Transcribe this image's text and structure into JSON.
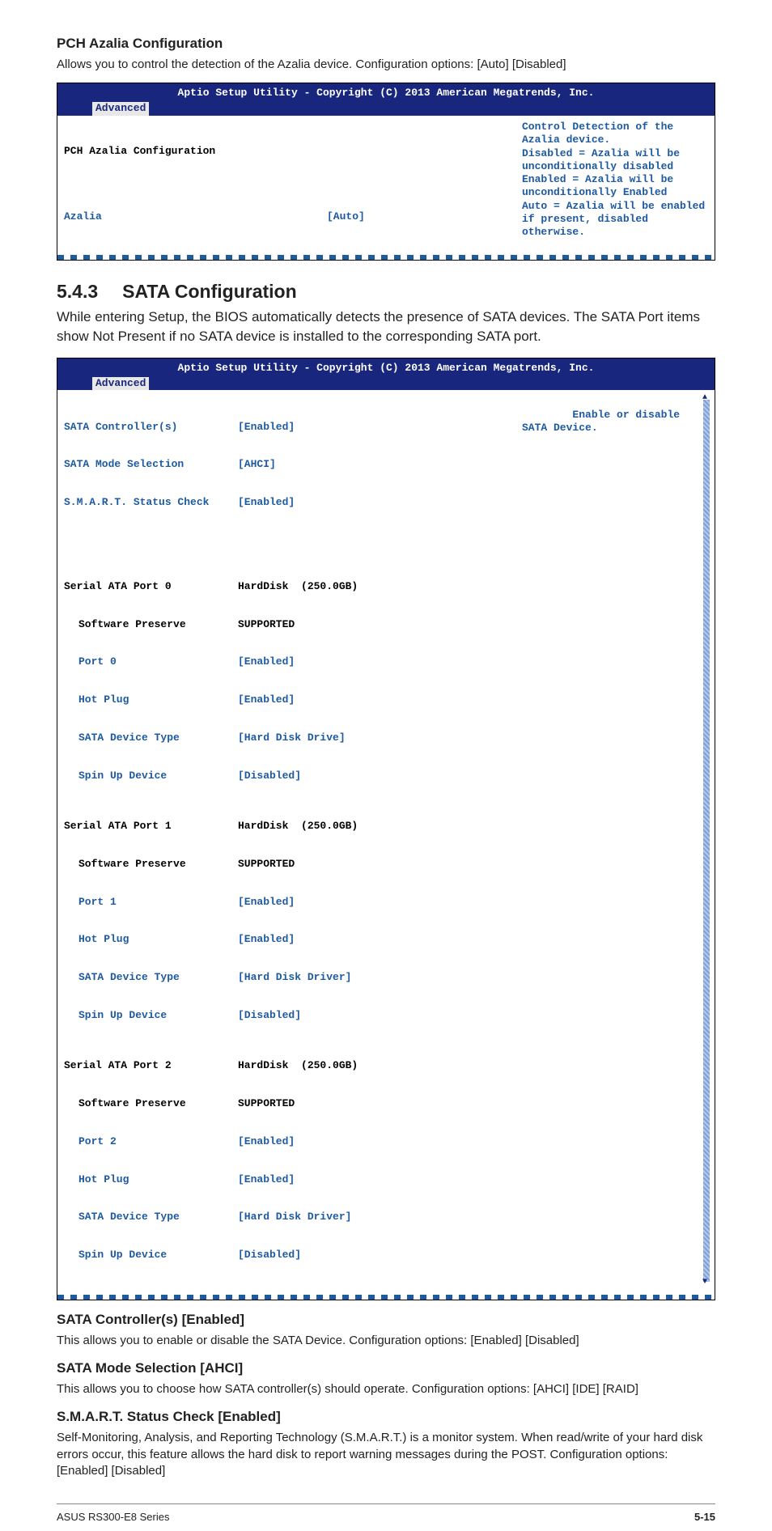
{
  "pch": {
    "heading": "PCH Azalia Configuration",
    "desc": "Allows you to control the detection of the Azalia device. Configuration options: [Auto] [Disabled]"
  },
  "bios1": {
    "title": "Aptio Setup Utility - Copyright (C) 2013 American Megatrends, Inc.",
    "tab": "Advanced",
    "left": {
      "row0_label": "PCH Azalia Configuration",
      "azalia_label": "Azalia",
      "azalia_value": "[Auto]"
    },
    "help": "Control Detection of the Azalia device.\nDisabled = Azalia will be unconditionally disabled\nEnabled = Azalia will be unconditionally Enabled\nAuto = Azalia will be enabled if present, disabled otherwise."
  },
  "section": {
    "number": "5.4.3",
    "title": "SATA Configuration",
    "intro": "While entering Setup, the BIOS automatically detects the presence of SATA devices. The SATA Port items show Not Present if no SATA device is installed to the corresponding SATA port."
  },
  "bios2": {
    "title": "Aptio Setup Utility - Copyright (C) 2013 American Megatrends, Inc.",
    "tab": "Advanced",
    "help": "Enable or disable SATA Device.",
    "rows": {
      "sata_controller_l": "SATA Controller(s)",
      "sata_controller_v": "[Enabled]",
      "sata_mode_l": "SATA Mode Selection",
      "sata_mode_v": "[AHCI]",
      "smart_l": "S.M.A.R.T. Status Check",
      "smart_v": "[Enabled]",
      "p0_l": "Serial ATA Port 0",
      "p0_v": "HardDisk  (250.0GB)",
      "p0_sw_l": "Software Preserve",
      "p0_sw_v": "SUPPORTED",
      "p0_port_l": "Port 0",
      "p0_port_v": "[Enabled]",
      "p0_hot_l": "Hot Plug",
      "p0_hot_v": "[Enabled]",
      "p0_type_l": "SATA Device Type",
      "p0_type_v": "[Hard Disk Drive]",
      "p0_spin_l": "Spin Up Device",
      "p0_spin_v": "[Disabled]",
      "p1_l": "Serial ATA Port 1",
      "p1_v": "HardDisk  (250.0GB)",
      "p1_sw_l": "Software Preserve",
      "p1_sw_v": "SUPPORTED",
      "p1_port_l": "Port 1",
      "p1_port_v": "[Enabled]",
      "p1_hot_l": "Hot Plug",
      "p1_hot_v": "[Enabled]",
      "p1_type_l": "SATA Device Type",
      "p1_type_v": "[Hard Disk Driver]",
      "p1_spin_l": "Spin Up Device",
      "p1_spin_v": "[Disabled]",
      "p2_l": "Serial ATA Port 2",
      "p2_v": "HardDisk  (250.0GB)",
      "p2_sw_l": "Software Preserve",
      "p2_sw_v": "SUPPORTED",
      "p2_port_l": "Port 2",
      "p2_port_v": "[Enabled]",
      "p2_hot_l": "Hot Plug",
      "p2_hot_v": "[Enabled]",
      "p2_type_l": "SATA Device Type",
      "p2_type_v": "[Hard Disk Driver]",
      "p2_spin_l": "Spin Up Device",
      "p2_spin_v": "[Disabled]"
    }
  },
  "sata_controller": {
    "heading": "SATA Controller(s) [Enabled]",
    "desc": "This allows you to enable or disable the SATA Device. Configuration options: [Enabled] [Disabled]"
  },
  "sata_mode": {
    "heading": "SATA Mode Selection [AHCI]",
    "desc": "This allows you to choose how SATA controller(s) should operate. Configuration options: [AHCI] [IDE] [RAID]"
  },
  "smart": {
    "heading": "S.M.A.R.T. Status Check [Enabled]",
    "desc": "Self-Monitoring, Analysis, and Reporting Technology (S.M.A.R.T.) is a monitor system. When read/write of your hard disk errors occur, this feature allows the hard disk to report warning messages during the POST. Configuration options: [Enabled] [Disabled]"
  },
  "footer": {
    "left": "ASUS RS300-E8 Series",
    "right": "5-15"
  }
}
